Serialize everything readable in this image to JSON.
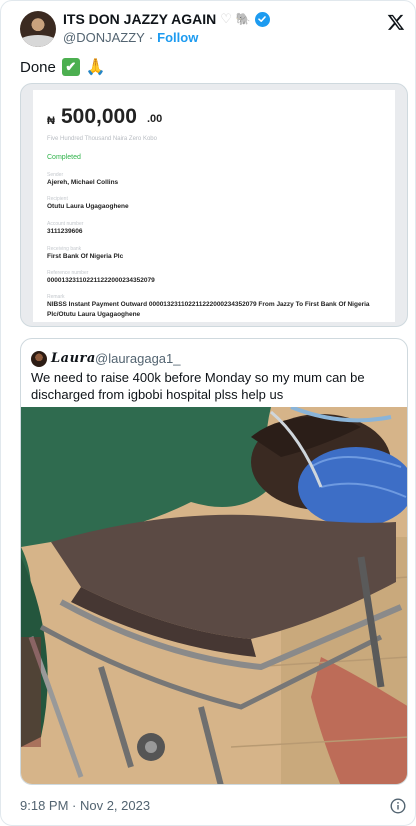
{
  "author": {
    "display_name": "ITS DON JAZZY AGAIN",
    "heart_glyph": "♡",
    "elephant_glyph": "🐘",
    "handle": "@DONJAZZY",
    "separator": "·",
    "follow_label": "Follow"
  },
  "tweet": {
    "text": "Done",
    "emoji_check": "✔",
    "emoji_pray": "🙏"
  },
  "receipt": {
    "currency_symbol": "₦",
    "amount": "500,000",
    "cents": ".00",
    "amount_words": "Five Hundred Thousand Naira Zero Kobo",
    "status": "Completed",
    "fields": [
      {
        "label": "Sender",
        "value": "Ajereh, Michael Collins"
      },
      {
        "label": "Recipient",
        "value": "Otutu Laura Ugagaoghene"
      },
      {
        "label": "Account number",
        "value": "3111239606"
      },
      {
        "label": "Receiving bank",
        "value": "First Bank Of Nigeria Plc"
      },
      {
        "label": "Reference number",
        "value": "000013231102211222000234352079"
      },
      {
        "label": "Remark",
        "value": "NIBSS Instant Payment Outward 000013231102211222000234352079 From Jazzy To First Bank Of Nigeria Plc/Otutu Laura Ugagaoghene"
      }
    ]
  },
  "quote": {
    "name": "Laura",
    "handle": "@lauragaga1_",
    "text": "We need to raise 400k before Monday  so my mum can be discharged from igbobi hospital plss help us"
  },
  "footer": {
    "timestamp": "9:18 PM · Nov 2, 2023"
  },
  "colors": {
    "accent": "#1d9bf0",
    "secondary_text": "#536471",
    "completed": "#2fb34a"
  }
}
